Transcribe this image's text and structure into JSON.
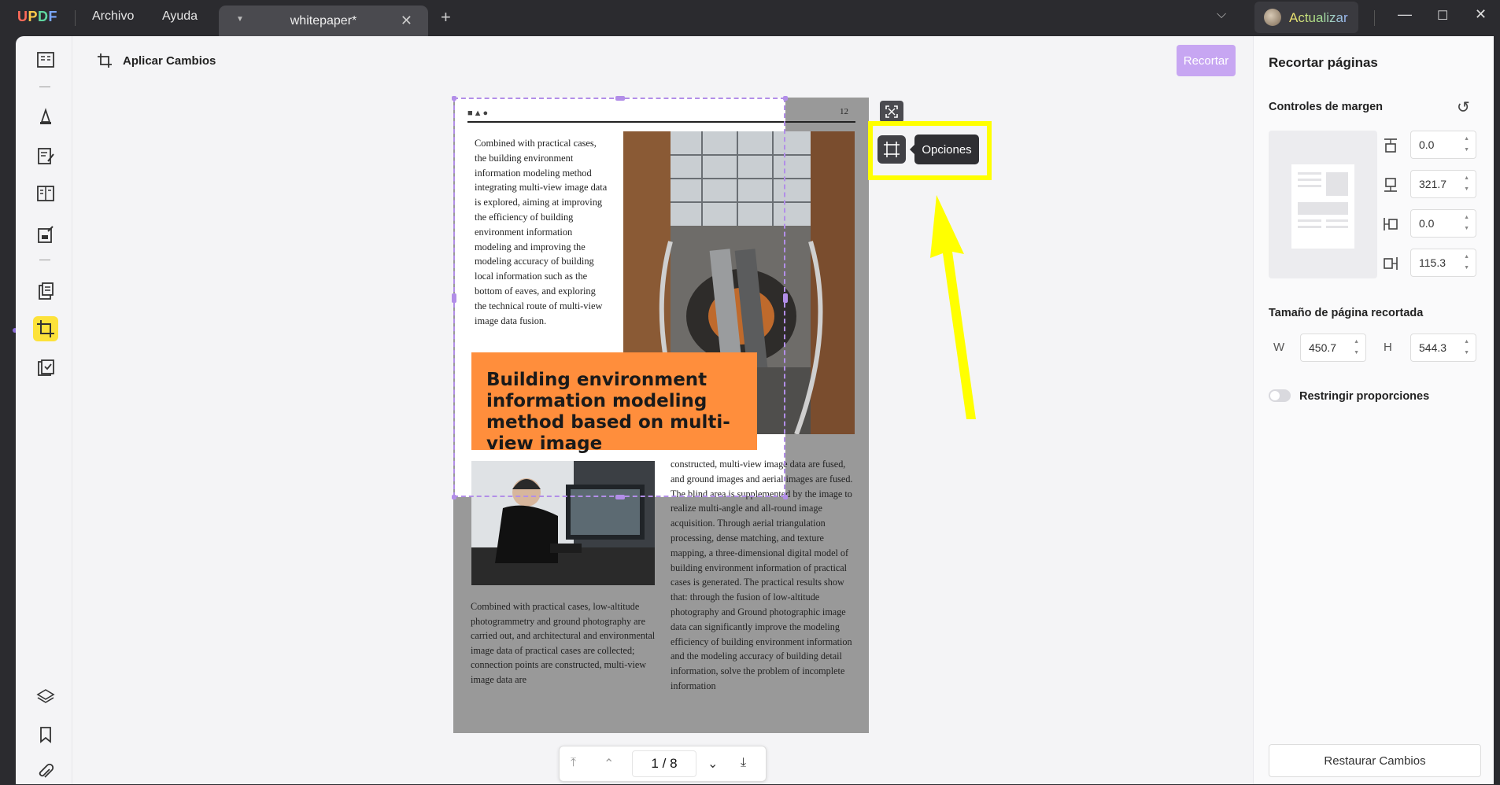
{
  "app": {
    "logo_text": "UPDF",
    "menu": [
      "Archivo",
      "Ayuda"
    ],
    "tab_title": "whitepaper*",
    "upgrade_label": "Actualizar"
  },
  "toolbar": {
    "icons": [
      "reader-icon",
      "comment-icon",
      "edit-pdf-icon",
      "page-organize-icon",
      "form-icon",
      "convert-icon",
      "crop-icon",
      "ocr-icon",
      "layers-icon",
      "bookmark-icon",
      "attachment-icon"
    ],
    "active": "crop-icon"
  },
  "header": {
    "apply_label": "Aplicar Cambios",
    "crop_label": "Recortar"
  },
  "document": {
    "header_glyphs": "■▲●",
    "page_number": "12",
    "para1": "Combined with practical cases, the building environment information modeling method integrating multi-view image data is explored, aiming at improving the efficiency of building environment information modeling and improving the modeling accuracy of building local information such as the bottom of eaves, and exploring the technical route of multi-view image data fusion.",
    "banner": "Building environment information modeling method based on multi-view image",
    "para2": "Combined with practical cases, low-altitude photogrammetry and ground photography are carried out, and architectural and environmental image data of practical cases are collected; connection points are constructed, multi-view image data are",
    "para3": "constructed, multi-view image data are fused, and ground images and aerial images are fused. The blind area is supplemented by the image to realize multi-angle and all-round image acquisition. Through aerial triangulation processing, dense matching, and texture mapping, a three-dimensional digital model of building environment information of practical cases is generated. The practical results show that: through the fusion of low-altitude photography and Ground photographic image data can significantly improve the modeling efficiency of building environment information and the modeling accuracy of building detail information, solve the problem of incomplete information"
  },
  "overlay": {
    "options_tooltip": "Opciones",
    "highlight_color": "#ffff00"
  },
  "pager": {
    "current": "1",
    "separator": "/",
    "total": "8"
  },
  "panel": {
    "title": "Recortar páginas",
    "margin_title": "Controles de margen",
    "margins": {
      "top": "0.0",
      "bottom": "321.7",
      "left": "0.0",
      "right": "115.3"
    },
    "size_title": "Tamaño de página recortada",
    "w_label": "W",
    "h_label": "H",
    "width": "450.7",
    "height": "544.3",
    "ratio_label": "Restringir proporciones",
    "restore_label": "Restaurar Cambios"
  },
  "colors": {
    "accent": "#c7a6f2",
    "banner": "#ff8e3c",
    "active_tool": "#fde23a"
  }
}
